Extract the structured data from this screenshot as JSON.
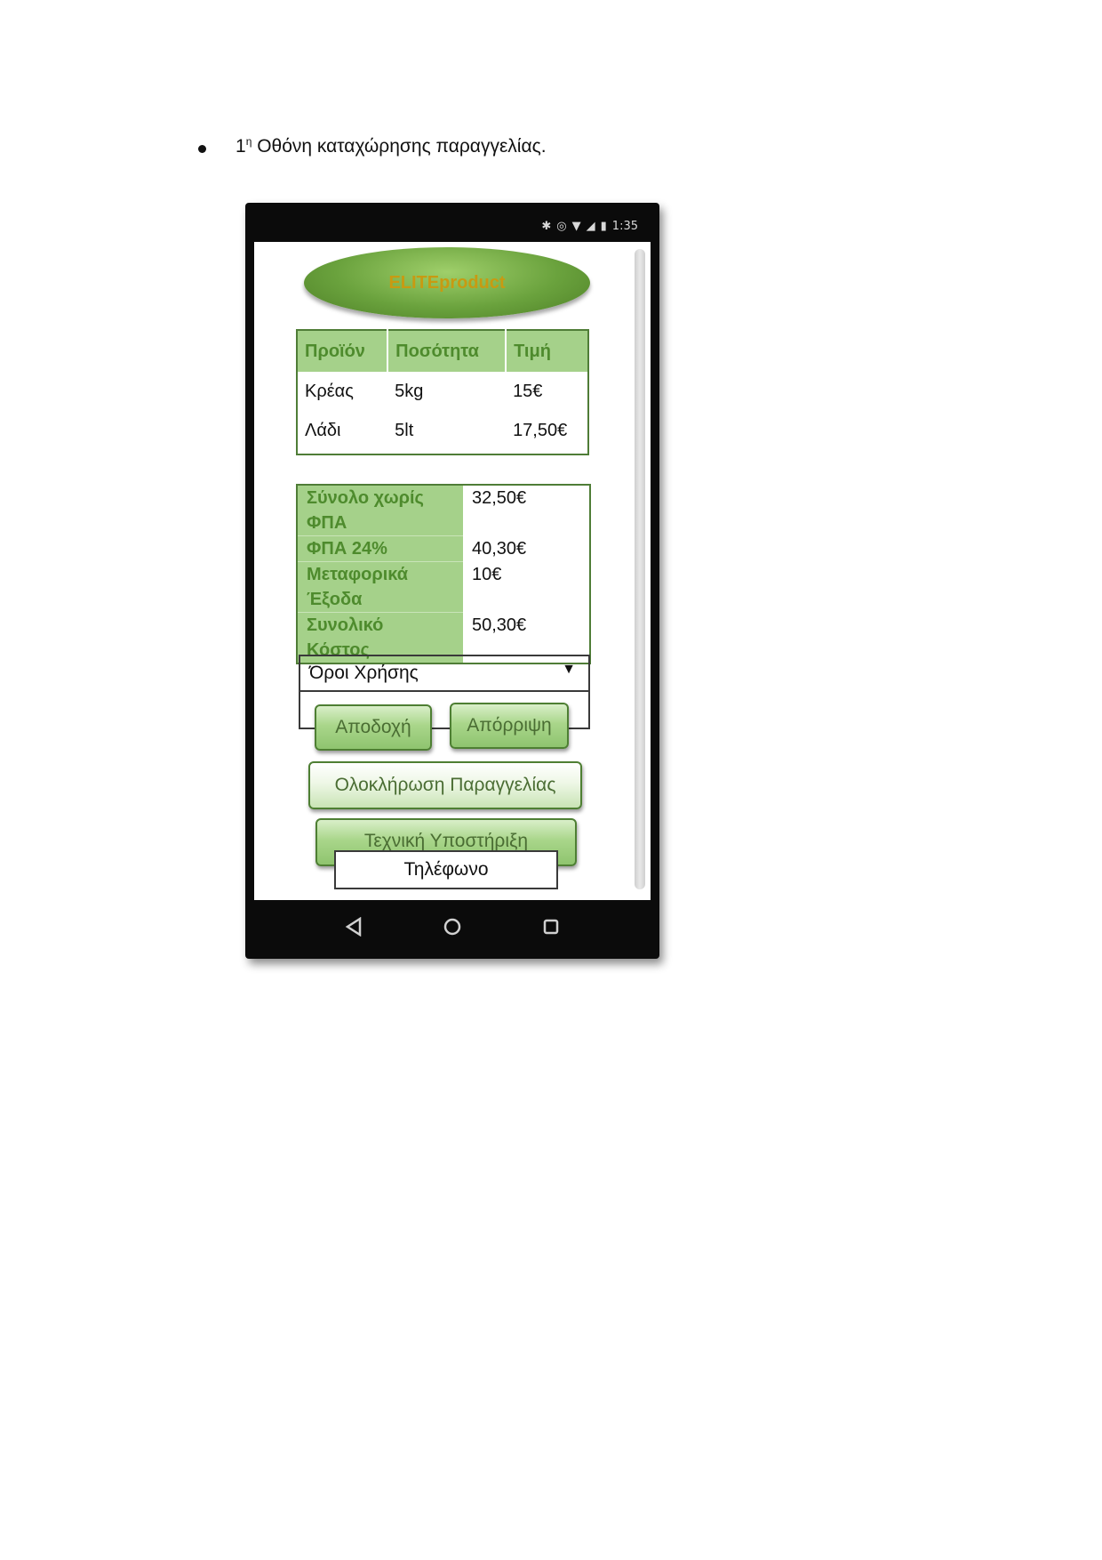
{
  "document": {
    "bullet_number": "1",
    "bullet_sup": "η",
    "bullet_text": "Οθόνη καταχώρησης παραγγελίας."
  },
  "status_bar": {
    "time": "1:35"
  },
  "app": {
    "brand": "ELITEproduct"
  },
  "products": {
    "headers": [
      "Προϊόν",
      "Ποσότητα",
      "Τιμή"
    ],
    "rows": [
      {
        "product": "Κρέας",
        "quantity": "5kg",
        "price": "15€"
      },
      {
        "product": "Λάδι",
        "quantity": "5lt",
        "price": "17,50€"
      }
    ]
  },
  "totals": {
    "subtotal_label_1": "Σύνολο χωρίς",
    "subtotal_label_2": "ΦΠΑ",
    "subtotal_value": "32,50€",
    "vat_label": "ΦΠΑ 24%",
    "vat_value": "40,30€",
    "shipping_label_1": "Μεταφορικά",
    "shipping_label_2": "Έξοδα",
    "shipping_value": "10€",
    "total_label_1": "Συνολικό",
    "total_label_2": "Κόστος",
    "total_value": "50,30€"
  },
  "terms": {
    "label": "Όροι Χρήσης",
    "accept": "Αποδοχή",
    "reject": "Απόρριψη"
  },
  "actions": {
    "complete": "Ολοκλήρωση Παραγγελίας",
    "support": "Τεχνική Υποστήριξη",
    "phone": "Τηλέφωνο"
  },
  "icons": {
    "status": [
      "bluetooth-icon",
      "alarm-icon",
      "wifi-icon",
      "signal-icon",
      "battery-icon"
    ],
    "nav": [
      "back-icon",
      "home-icon",
      "recents-icon"
    ]
  }
}
